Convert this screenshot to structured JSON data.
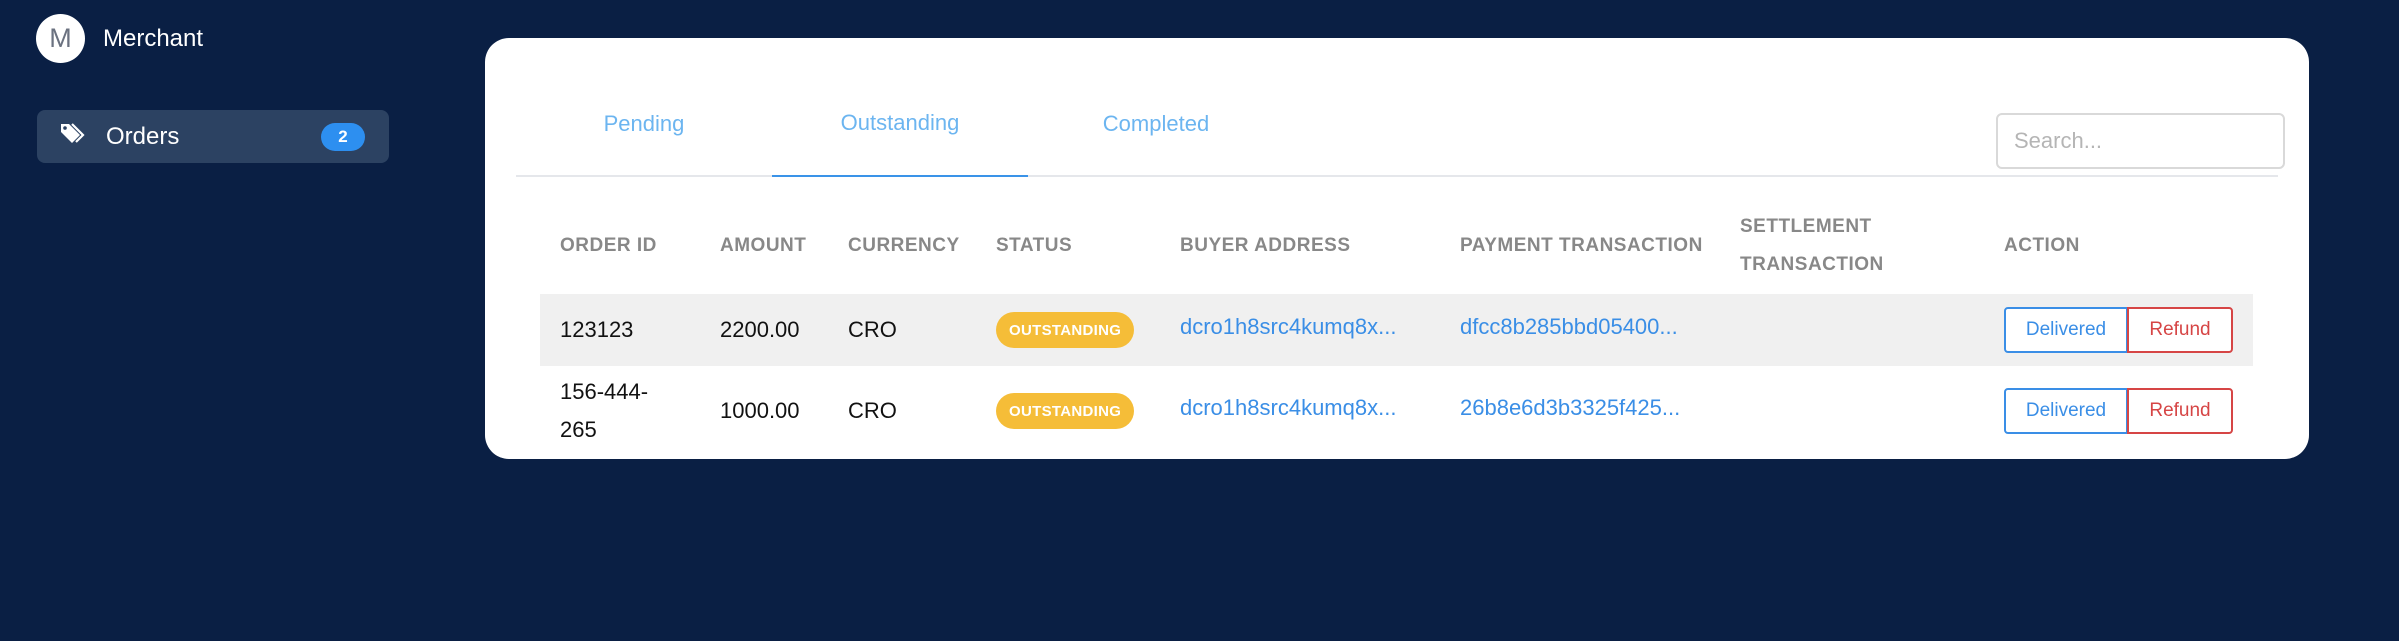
{
  "brand": {
    "avatar_letter": "M",
    "name": "Merchant"
  },
  "sidebar": {
    "items": [
      {
        "label": "Orders",
        "icon": "tags-icon",
        "badge": "2"
      }
    ]
  },
  "tabs": [
    {
      "label": "Pending",
      "active": false
    },
    {
      "label": "Outstanding",
      "active": true
    },
    {
      "label": "Completed",
      "active": false
    }
  ],
  "search": {
    "placeholder": "Search...",
    "value": ""
  },
  "table": {
    "columns": [
      "ORDER ID",
      "AMOUNT",
      "CURRENCY",
      "STATUS",
      "BUYER ADDRESS",
      "PAYMENT TRANSACTION",
      "SETTLEMENT TRANSACTION",
      "ACTION"
    ],
    "rows": [
      {
        "order_id": "123123",
        "amount": "2200.00",
        "currency": "CRO",
        "status": "OUTSTANDING",
        "buyer_address": "dcro1h8src4kumq8x...",
        "payment_transaction": "dfcc8b285bbd05400...",
        "settlement_transaction": "",
        "actions": {
          "delivered": "Delivered",
          "refund": "Refund"
        }
      },
      {
        "order_id": "156-444-265",
        "amount": "1000.00",
        "currency": "CRO",
        "status": "OUTSTANDING",
        "buyer_address": "dcro1h8src4kumq8x...",
        "payment_transaction": "26b8e6d3b3325f425...",
        "settlement_transaction": "",
        "actions": {
          "delivered": "Delivered",
          "refund": "Refund"
        }
      }
    ]
  },
  "colors": {
    "background": "#0a1f44",
    "sidebar_item_bg": "#2c4262",
    "accent": "#3a8ee6",
    "status_outstanding": "#f5bd38",
    "refund": "#d64545"
  }
}
